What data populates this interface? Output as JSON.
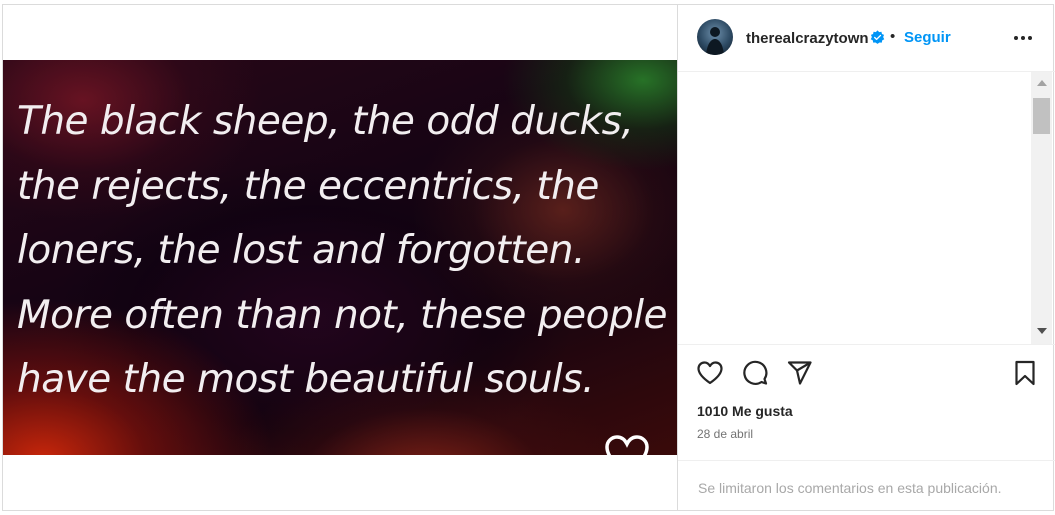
{
  "post": {
    "quote": "The black sheep, the odd ducks,\nthe rejects, the eccentrics, the\nloners, the lost and forgotten.\nMore often than not, these people\nhave the most beautiful souls."
  },
  "header": {
    "username": "therealcrazytown",
    "separator": "•",
    "follow_label": "Seguir"
  },
  "icons": {
    "verified": "verified-badge-icon",
    "more": "more-options-icon",
    "like": "heart-icon",
    "comment": "comment-bubble-icon",
    "share": "paper-plane-icon",
    "save": "bookmark-icon"
  },
  "engagement": {
    "likes": "1010 Me gusta",
    "date": "28 de abril"
  },
  "comments": {
    "limited_notice": "Se limitaron los comentarios en esta publicación."
  },
  "colors": {
    "accent": "#0095f6",
    "verified": "#0095f6",
    "text": "#262626",
    "muted": "#737373"
  }
}
